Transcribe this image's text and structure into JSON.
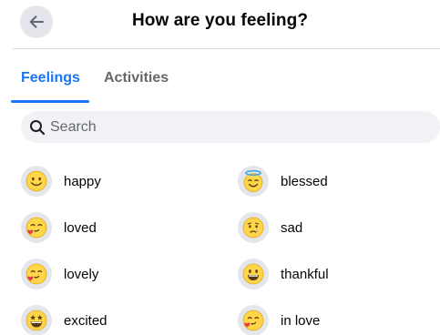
{
  "header": {
    "title": "How are you feeling?",
    "back_icon": "arrow-left-icon"
  },
  "tabs": [
    {
      "label": "Feelings",
      "active": true
    },
    {
      "label": "Activities",
      "active": false
    }
  ],
  "search": {
    "placeholder": "Search",
    "value": "",
    "icon": "search-icon"
  },
  "colors": {
    "accent": "#1877f2",
    "muted_text": "#65676b",
    "chip_bg": "#e4e6eb",
    "search_bg": "#f0f2f5"
  },
  "feelings": [
    {
      "label": "happy",
      "icon": "happy-emoji-icon"
    },
    {
      "label": "blessed",
      "icon": "halo-emoji-icon"
    },
    {
      "label": "loved",
      "icon": "heart-kiss-emoji-icon"
    },
    {
      "label": "sad",
      "icon": "sad-emoji-icon"
    },
    {
      "label": "lovely",
      "icon": "heart-kiss-emoji-icon"
    },
    {
      "label": "thankful",
      "icon": "grin-emoji-icon"
    },
    {
      "label": "excited",
      "icon": "star-eyes-emoji-icon"
    },
    {
      "label": "in love",
      "icon": "heart-kiss-emoji-icon"
    }
  ]
}
